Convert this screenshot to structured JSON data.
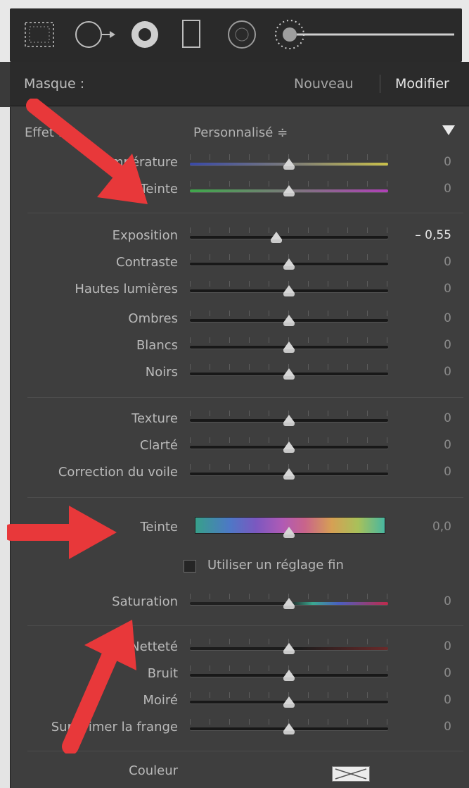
{
  "mask_header": {
    "label": "Masque :",
    "new_label": "Nouveau",
    "edit_label": "Modifier"
  },
  "effect": {
    "label": "Effet :",
    "preset": "Personnalisé",
    "updown": "≑"
  },
  "sliders": {
    "temperature": {
      "label": "Température",
      "value": "0"
    },
    "tint": {
      "label": "Teinte",
      "value": "0"
    },
    "exposure": {
      "label": "Exposition",
      "value": "– 0,55"
    },
    "contrast": {
      "label": "Contraste",
      "value": "0"
    },
    "highlights": {
      "label": "Hautes lumières",
      "value": "0"
    },
    "shadows": {
      "label": "Ombres",
      "value": "0"
    },
    "whites": {
      "label": "Blancs",
      "value": "0"
    },
    "blacks": {
      "label": "Noirs",
      "value": "0"
    },
    "texture": {
      "label": "Texture",
      "value": "0"
    },
    "clarity": {
      "label": "Clarté",
      "value": "0"
    },
    "dehaze": {
      "label": "Correction du voile",
      "value": "0"
    },
    "hue": {
      "label": "Teinte",
      "value": "0,0"
    },
    "saturation": {
      "label": "Saturation",
      "value": "0"
    },
    "sharpness": {
      "label": "Netteté",
      "value": "0"
    },
    "noise": {
      "label": "Bruit",
      "value": "0"
    },
    "moire": {
      "label": "Moiré",
      "value": "0"
    },
    "defringe": {
      "label": "Supprimer la frange",
      "value": "0"
    }
  },
  "fine_adjust": {
    "label": "Utiliser un réglage fin"
  },
  "color": {
    "label": "Couleur"
  },
  "accent": {
    "arrow_color": "#e8383a"
  }
}
